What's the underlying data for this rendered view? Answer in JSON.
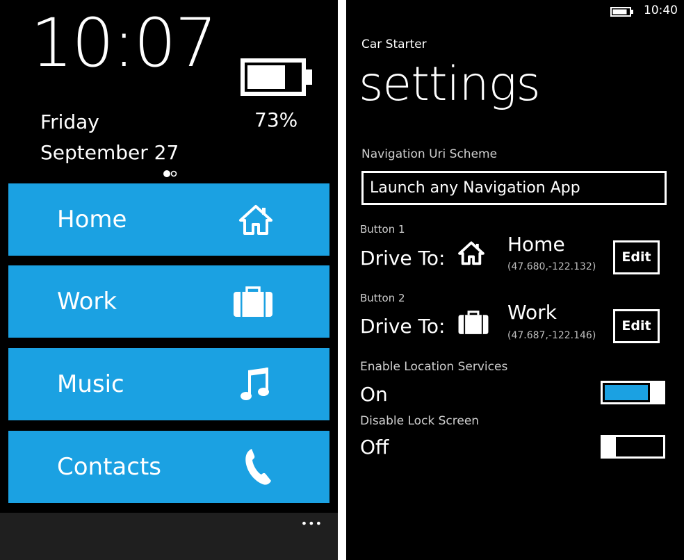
{
  "colors": {
    "accent": "#1ba1e2",
    "background": "#000000",
    "foreground": "#ffffff",
    "appbar": "#1f1f1f"
  },
  "lock_screen": {
    "time": "10:07",
    "day": "Friday",
    "date": "September 27",
    "battery_percent": "73%",
    "battery_level": 0.73,
    "tiles": [
      {
        "label": "Home",
        "icon": "home-icon"
      },
      {
        "label": "Work",
        "icon": "briefcase-icon"
      },
      {
        "label": "Music",
        "icon": "music-note-icon"
      },
      {
        "label": "Contacts",
        "icon": "phone-icon"
      }
    ],
    "more_label": "•••"
  },
  "settings": {
    "status_time": "10:40",
    "app_name": "Car Starter",
    "page_title": "settings",
    "nav_scheme": {
      "label": "Navigation Uri Scheme",
      "value": "Launch any Navigation App"
    },
    "buttons": [
      {
        "header": "Button 1",
        "prefix": "Drive To:",
        "icon": "home-icon",
        "name": "Home",
        "coords": "(47.680,-122.132)",
        "edit_label": "Edit"
      },
      {
        "header": "Button 2",
        "prefix": "Drive To:",
        "icon": "briefcase-icon",
        "name": "Work",
        "coords": "(47.687,-122.146)",
        "edit_label": "Edit"
      }
    ],
    "location_services": {
      "label": "Enable Location Services",
      "value": "On",
      "enabled": true
    },
    "lock_screen_toggle": {
      "label": "Disable Lock Screen",
      "value": "Off",
      "enabled": false
    }
  }
}
